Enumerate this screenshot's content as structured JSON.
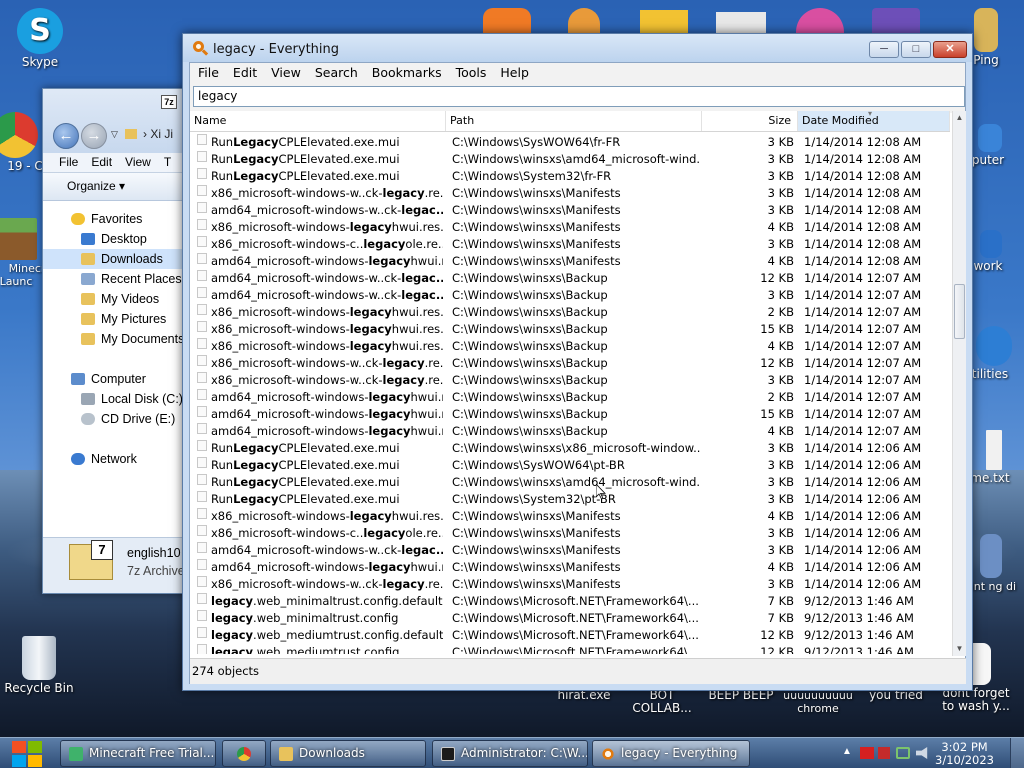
{
  "desktop": {
    "icons_left": [
      {
        "label": "Skype",
        "color": "#1a9fe0"
      },
      {
        "label": "19 - C",
        "color": "#dc3b2f"
      },
      {
        "label": "Minecr Launc",
        "color": "#5d8c3a"
      },
      {
        "label": "Recycle Bin",
        "color": "#c9d4e0"
      }
    ],
    "icons_right": [
      {
        "label": "Ping",
        "color": "#d8b45a"
      },
      {
        "label": "puter",
        "color": "#3a84d8"
      },
      {
        "label": "work",
        "color": "#2a70c8"
      },
      {
        "label": "tilities",
        "color": "#2d7ed4"
      },
      {
        "label": "me.txt",
        "color": "#f1f1f1"
      },
      {
        "label": "aint ng di",
        "color": "#6c8fc4"
      }
    ],
    "icons_top": [
      {
        "color": "#f07a25"
      },
      {
        "color": "#e89a3a"
      },
      {
        "color": "#f2c232"
      },
      {
        "color": "#e8e8e8"
      },
      {
        "color": "#d94fa1"
      },
      {
        "color": "#6d4fb8"
      }
    ],
    "icons_bottom": [
      {
        "label": "hirat.exe"
      },
      {
        "label": "BOT COLLAB..."
      },
      {
        "label": "BEEP BEEP"
      },
      {
        "label": "uuuuuuuuuu chrome"
      },
      {
        "label": "you tried"
      },
      {
        "label": "dont forget to wash y..."
      }
    ]
  },
  "explorer": {
    "title_partial": "Xi Ji",
    "menu": [
      "File",
      "Edit",
      "View",
      "T"
    ],
    "organize_label": "Organize",
    "nav_items": [
      {
        "label": "Favorites",
        "icon": "star-icon",
        "color": "#f2c232"
      },
      {
        "label": "Desktop",
        "icon": "desktop-icon",
        "color": "#3a7ad0"
      },
      {
        "label": "Downloads",
        "icon": "downloads-folder-icon",
        "color": "#e8c25c",
        "selected": true
      },
      {
        "label": "Recent Places",
        "icon": "recent-places-icon",
        "color": "#8aa8d0"
      },
      {
        "label": "My Videos",
        "icon": "videos-folder-icon",
        "color": "#e8c25c"
      },
      {
        "label": "My Pictures",
        "icon": "pictures-folder-icon",
        "color": "#e8c25c"
      },
      {
        "label": "My Documents",
        "icon": "documents-folder-icon",
        "color": "#e8c25c"
      },
      {
        "label": "Computer",
        "icon": "computer-icon",
        "color": "#5c8ccc",
        "section": true
      },
      {
        "label": "Local Disk (C:)",
        "icon": "disk-icon",
        "color": "#9aa6b4"
      },
      {
        "label": "CD Drive (E:)",
        "icon": "cd-drive-icon",
        "color": "#b8c2cc"
      },
      {
        "label": "Network",
        "icon": "network-icon",
        "color": "#3a7ad0",
        "section": true
      }
    ],
    "file_name": "english10",
    "file_type": "7z Archive"
  },
  "everything": {
    "title": "legacy - Everything",
    "menu": [
      "File",
      "Edit",
      "View",
      "Search",
      "Bookmarks",
      "Tools",
      "Help"
    ],
    "search_value": "legacy",
    "columns": {
      "name": "Name",
      "path": "Path",
      "size": "Size",
      "date": "Date Modified"
    },
    "status": "274 objects",
    "rows": [
      {
        "pre": "Run",
        "hl": "Legacy",
        "post": "CPLElevated.exe.mui",
        "path": "C:\\Windows\\SysWOW64\\fr-FR",
        "size": "3 KB",
        "date": "1/14/2014 12:08 AM"
      },
      {
        "pre": "Run",
        "hl": "Legacy",
        "post": "CPLElevated.exe.mui",
        "path": "C:\\Windows\\winsxs\\amd64_microsoft-wind...",
        "size": "3 KB",
        "date": "1/14/2014 12:08 AM"
      },
      {
        "pre": "Run",
        "hl": "Legacy",
        "post": "CPLElevated.exe.mui",
        "path": "C:\\Windows\\System32\\fr-FR",
        "size": "3 KB",
        "date": "1/14/2014 12:08 AM"
      },
      {
        "pre": "x86_microsoft-windows-w..ck-",
        "hl": "legacy",
        "post": ".re...",
        "path": "C:\\Windows\\winsxs\\Manifests",
        "size": "3 KB",
        "date": "1/14/2014 12:08 AM"
      },
      {
        "pre": "amd64_microsoft-windows-w..ck-",
        "hl": "legac...",
        "post": "",
        "path": "C:\\Windows\\winsxs\\Manifests",
        "size": "3 KB",
        "date": "1/14/2014 12:08 AM"
      },
      {
        "pre": "x86_microsoft-windows-",
        "hl": "legacy",
        "post": "hwui.res...",
        "path": "C:\\Windows\\winsxs\\Manifests",
        "size": "4 KB",
        "date": "1/14/2014 12:08 AM"
      },
      {
        "pre": "x86_microsoft-windows-c..",
        "hl": "legacy",
        "post": "ole.re...",
        "path": "C:\\Windows\\winsxs\\Manifests",
        "size": "3 KB",
        "date": "1/14/2014 12:08 AM"
      },
      {
        "pre": "amd64_microsoft-windows-",
        "hl": "legacy",
        "post": "hwui.r...",
        "path": "C:\\Windows\\winsxs\\Manifests",
        "size": "4 KB",
        "date": "1/14/2014 12:08 AM"
      },
      {
        "pre": "amd64_microsoft-windows-w..ck-",
        "hl": "legac...",
        "post": "",
        "path": "C:\\Windows\\winsxs\\Backup",
        "size": "12 KB",
        "date": "1/14/2014 12:07 AM"
      },
      {
        "pre": "amd64_microsoft-windows-w..ck-",
        "hl": "legac...",
        "post": "",
        "path": "C:\\Windows\\winsxs\\Backup",
        "size": "3 KB",
        "date": "1/14/2014 12:07 AM"
      },
      {
        "pre": "x86_microsoft-windows-",
        "hl": "legacy",
        "post": "hwui.res...",
        "path": "C:\\Windows\\winsxs\\Backup",
        "size": "2 KB",
        "date": "1/14/2014 12:07 AM"
      },
      {
        "pre": "x86_microsoft-windows-",
        "hl": "legacy",
        "post": "hwui.res...",
        "path": "C:\\Windows\\winsxs\\Backup",
        "size": "15 KB",
        "date": "1/14/2014 12:07 AM"
      },
      {
        "pre": "x86_microsoft-windows-",
        "hl": "legacy",
        "post": "hwui.res...",
        "path": "C:\\Windows\\winsxs\\Backup",
        "size": "4 KB",
        "date": "1/14/2014 12:07 AM"
      },
      {
        "pre": "x86_microsoft-windows-w..ck-",
        "hl": "legacy",
        "post": ".re...",
        "path": "C:\\Windows\\winsxs\\Backup",
        "size": "12 KB",
        "date": "1/14/2014 12:07 AM"
      },
      {
        "pre": "x86_microsoft-windows-w..ck-",
        "hl": "legacy",
        "post": ".re...",
        "path": "C:\\Windows\\winsxs\\Backup",
        "size": "3 KB",
        "date": "1/14/2014 12:07 AM"
      },
      {
        "pre": "amd64_microsoft-windows-",
        "hl": "legacy",
        "post": "hwui.r...",
        "path": "C:\\Windows\\winsxs\\Backup",
        "size": "2 KB",
        "date": "1/14/2014 12:07 AM"
      },
      {
        "pre": "amd64_microsoft-windows-",
        "hl": "legacy",
        "post": "hwui.r...",
        "path": "C:\\Windows\\winsxs\\Backup",
        "size": "15 KB",
        "date": "1/14/2014 12:07 AM"
      },
      {
        "pre": "amd64_microsoft-windows-",
        "hl": "legacy",
        "post": "hwui.r...",
        "path": "C:\\Windows\\winsxs\\Backup",
        "size": "4 KB",
        "date": "1/14/2014 12:07 AM"
      },
      {
        "pre": "Run",
        "hl": "Legacy",
        "post": "CPLElevated.exe.mui",
        "path": "C:\\Windows\\winsxs\\x86_microsoft-window...",
        "size": "3 KB",
        "date": "1/14/2014 12:06 AM"
      },
      {
        "pre": "Run",
        "hl": "Legacy",
        "post": "CPLElevated.exe.mui",
        "path": "C:\\Windows\\SysWOW64\\pt-BR",
        "size": "3 KB",
        "date": "1/14/2014 12:06 AM"
      },
      {
        "pre": "Run",
        "hl": "Legacy",
        "post": "CPLElevated.exe.mui",
        "path": "C:\\Windows\\winsxs\\amd64_microsoft-wind...",
        "size": "3 KB",
        "date": "1/14/2014 12:06 AM"
      },
      {
        "pre": "Run",
        "hl": "Legacy",
        "post": "CPLElevated.exe.mui",
        "path": "C:\\Windows\\System32\\pt-BR",
        "size": "3 KB",
        "date": "1/14/2014 12:06 AM"
      },
      {
        "pre": "x86_microsoft-windows-",
        "hl": "legacy",
        "post": "hwui.res...",
        "path": "C:\\Windows\\winsxs\\Manifests",
        "size": "4 KB",
        "date": "1/14/2014 12:06 AM"
      },
      {
        "pre": "x86_microsoft-windows-c..",
        "hl": "legacy",
        "post": "ole.re...",
        "path": "C:\\Windows\\winsxs\\Manifests",
        "size": "3 KB",
        "date": "1/14/2014 12:06 AM"
      },
      {
        "pre": "amd64_microsoft-windows-w..ck-",
        "hl": "legac...",
        "post": "",
        "path": "C:\\Windows\\winsxs\\Manifests",
        "size": "3 KB",
        "date": "1/14/2014 12:06 AM"
      },
      {
        "pre": "amd64_microsoft-windows-",
        "hl": "legacy",
        "post": "hwui.r...",
        "path": "C:\\Windows\\winsxs\\Manifests",
        "size": "4 KB",
        "date": "1/14/2014 12:06 AM"
      },
      {
        "pre": "x86_microsoft-windows-w..ck-",
        "hl": "legacy",
        "post": ".re...",
        "path": "C:\\Windows\\winsxs\\Manifests",
        "size": "3 KB",
        "date": "1/14/2014 12:06 AM"
      },
      {
        "pre": "",
        "hl": "legacy",
        "post": ".web_minimaltrust.config.default",
        "path": "C:\\Windows\\Microsoft.NET\\Framework64\\...",
        "size": "7 KB",
        "date": "9/12/2013 1:46 AM"
      },
      {
        "pre": "",
        "hl": "legacy",
        "post": ".web_minimaltrust.config",
        "path": "C:\\Windows\\Microsoft.NET\\Framework64\\...",
        "size": "7 KB",
        "date": "9/12/2013 1:46 AM"
      },
      {
        "pre": "",
        "hl": "legacy",
        "post": ".web_mediumtrust.config.default",
        "path": "C:\\Windows\\Microsoft.NET\\Framework64\\...",
        "size": "12 KB",
        "date": "9/12/2013 1:46 AM"
      },
      {
        "pre": "",
        "hl": "legacy",
        "post": ".web_mediumtrust.config",
        "path": "C:\\Windows\\Microsoft.NET\\Framework64\\...",
        "size": "12 KB",
        "date": "9/12/2013 1:46 AM"
      }
    ]
  },
  "taskbar": {
    "buttons": [
      {
        "label": "Minecraft Free Trial...",
        "icon": "minecraft-icon",
        "color": "#3fb26b"
      },
      {
        "label": "",
        "icon": "chrome-icon",
        "color": "#e3463b"
      },
      {
        "label": "Downloads",
        "icon": "folder-icon",
        "color": "#e8c25c"
      },
      {
        "label": "Administrator: C:\\W...",
        "icon": "cmd-icon",
        "color": "#1b1b1b"
      },
      {
        "label": "legacy - Everything",
        "icon": "everything-icon",
        "color": "#e07a10",
        "active": true
      }
    ],
    "time": "3:02 PM",
    "date": "3/10/2023"
  }
}
